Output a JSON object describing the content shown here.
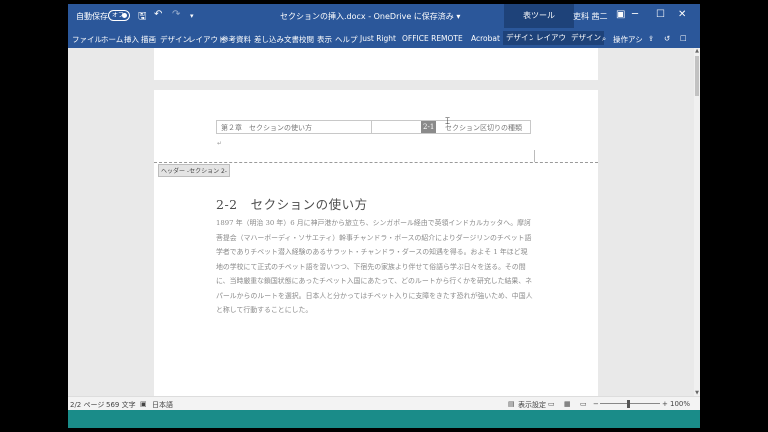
{
  "titlebar": {
    "autosave": "自動保存",
    "autosave_state": "オフ",
    "doc_title": "セクションの挿入.docx - OneDrive に保存済み ▾",
    "context_tools": "表ツール",
    "user": "吏科 茜二"
  },
  "ribbon": {
    "tabs": [
      "ファイル",
      "ホーム",
      "挿入",
      "描画",
      "デザイン",
      "レイアウト",
      "参考資料",
      "差し込み文書",
      "校閲",
      "表示",
      "ヘルプ",
      "Just Right",
      "OFFICE REMOTE",
      "Acrobat"
    ],
    "context_tabs": [
      "デザイン",
      "レイアウト",
      "デザイン"
    ],
    "tell_me": "操作アシ"
  },
  "document": {
    "header_cell_left": "第２章　セクションの使い方",
    "header_cell_num": "2-1",
    "header_cell_right": "セクション区切りの種類",
    "header_tag": "ヘッダー -セクション 2-",
    "heading": "2-2　セクションの使い方",
    "body": "1897 年（明治 30 年）6 月に神戸港から旅立ち、シンガポール経由で英領インドカルカッタへ。摩訶菩提会（マハーボーディ・ソサエティ）幹事チャンドラ・ボースの紹介によりダージリンのチベット語学者でありチベット潜入経験のあるサラット・チャンドラ・ダースの知遇を得る。およそ 1 年ほど現地の学校にて正式のチベット語を習いつつ、下宿先の家族より伴せて俗語ら学ぶ日々を送る。その間に、当時厳重な鎖国状態にあったチベット入国にあたって、どのルートから行くかを研究した結果、ネパールからのルートを選択。日本人と分かってはチベット入りに支障をきたす恐れが強いため、中国人と称して行動することにした。"
  },
  "statusbar": {
    "page": "2/2 ページ",
    "words": "569 文字",
    "language": "日本語",
    "display_settings": "表示設定",
    "zoom": "100%"
  }
}
